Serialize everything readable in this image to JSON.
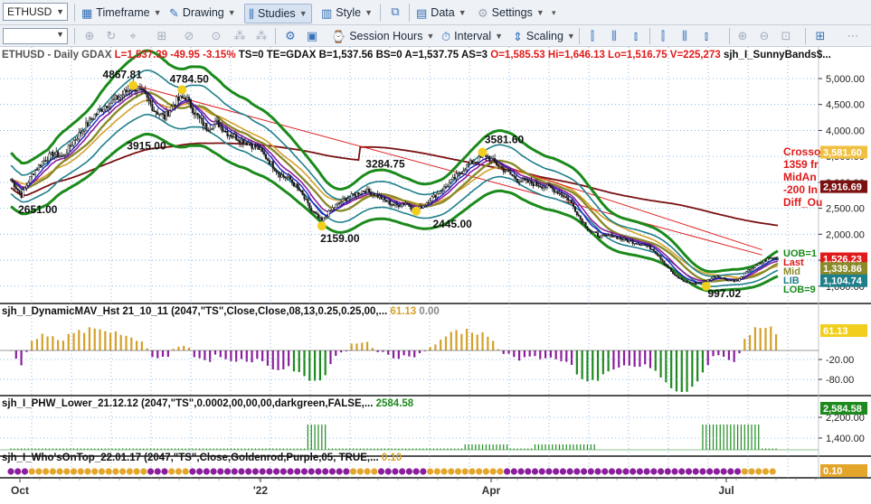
{
  "toolbar": {
    "symbol": "ETHUSD",
    "timeframe_label": "Timeframe",
    "drawing_label": "Drawing",
    "studies_label": "Studies",
    "style_label": "Style",
    "data_label": "Data",
    "settings_label": "Settings",
    "session_hours_label": "Session Hours",
    "interval_label": "Interval",
    "scaling_label": "Scaling"
  },
  "header": {
    "symbol_desc": "ETHUSD - Daily  GDAX",
    "low_change": "L=1,537.39  -49.95  -3.15%",
    "meta1": "TS=0  TE=GDAX  B=1,537.56  BS=0  A=1,537.75  AS=3",
    "ohlc": "O=1,585.53  Hi=1,646.13  Lo=1,516.75  V=225,273",
    "study": "sjh_I_SunnyBands$..."
  },
  "colors": {
    "up_candle": "#1a1a1a",
    "outer_band": "#1b8a1b",
    "inner_band": "#1f7f8a",
    "mid_blue": "#2020c8",
    "mid_purple": "#8a1e9c",
    "mid_olive": "#8a8a2a",
    "gold": "#d4a02a",
    "long_ma": "#7a1010",
    "trend": "#e02020",
    "hist_gold": "#d4a02a",
    "hist_red": "#e01a1a",
    "hist_purple": "#8a1e9c",
    "hist_green": "#1e8a1e"
  },
  "chart_data": [
    {
      "type": "candlestick",
      "title": "ETHUSD - Daily GDAX",
      "x_labels": [
        "Oct",
        "'22",
        "Apr",
        "Jul"
      ],
      "y_ticks": [
        1000,
        1500,
        2000,
        2500,
        3000,
        3500,
        4000,
        4500,
        5000
      ],
      "y_tick_labels": [
        "1,000.00",
        "1,500.00",
        "2,000.00",
        "2,500.00",
        "3,000.00",
        "3,500.00",
        "4,000.00",
        "4,500.00",
        "5,000.00"
      ],
      "ylim": [
        700,
        5400
      ],
      "close_path": [
        [
          0,
          3050
        ],
        [
          6,
          2750
        ],
        [
          12,
          3150
        ],
        [
          18,
          3400
        ],
        [
          24,
          3550
        ],
        [
          30,
          3500
        ],
        [
          36,
          3800
        ],
        [
          42,
          4050
        ],
        [
          48,
          4300
        ],
        [
          54,
          4480
        ],
        [
          60,
          4600
        ],
        [
          66,
          4750
        ],
        [
          70,
          4850
        ],
        [
          76,
          4700
        ],
        [
          82,
          4400
        ],
        [
          88,
          4250
        ],
        [
          94,
          4550
        ],
        [
          100,
          4650
        ],
        [
          106,
          4300
        ],
        [
          112,
          4050
        ],
        [
          118,
          4150
        ],
        [
          124,
          3950
        ],
        [
          130,
          3850
        ],
        [
          136,
          3750
        ],
        [
          142,
          3650
        ],
        [
          148,
          3400
        ],
        [
          154,
          3150
        ],
        [
          160,
          3050
        ],
        [
          166,
          2800
        ],
        [
          172,
          2450
        ],
        [
          178,
          2250
        ],
        [
          184,
          2500
        ],
        [
          190,
          2650
        ],
        [
          196,
          2750
        ],
        [
          202,
          2850
        ],
        [
          208,
          2780
        ],
        [
          214,
          2650
        ],
        [
          220,
          2550
        ],
        [
          226,
          2600
        ],
        [
          232,
          2450
        ],
        [
          238,
          2620
        ],
        [
          244,
          2780
        ],
        [
          250,
          2950
        ],
        [
          256,
          3150
        ],
        [
          262,
          3350
        ],
        [
          268,
          3450
        ],
        [
          272,
          3520
        ],
        [
          278,
          3350
        ],
        [
          284,
          3200
        ],
        [
          290,
          3050
        ],
        [
          296,
          3000
        ],
        [
          302,
          2950
        ],
        [
          308,
          2900
        ],
        [
          314,
          2800
        ],
        [
          320,
          2650
        ],
        [
          326,
          2300
        ],
        [
          332,
          2050
        ],
        [
          338,
          1950
        ],
        [
          344,
          1980
        ],
        [
          350,
          1900
        ],
        [
          356,
          1850
        ],
        [
          362,
          1800
        ],
        [
          368,
          1700
        ],
        [
          374,
          1450
        ],
        [
          380,
          1200
        ],
        [
          386,
          1080
        ],
        [
          392,
          1050
        ],
        [
          398,
          1100
        ],
        [
          404,
          1200
        ],
        [
          410,
          1120
        ],
        [
          416,
          1100
        ],
        [
          422,
          1300
        ],
        [
          428,
          1420
        ],
        [
          434,
          1537
        ]
      ],
      "annotations": [
        {
          "text": "4867.81",
          "value": 4867.81
        },
        {
          "text": "4784.50",
          "value": 4784.5
        },
        {
          "text": "3915.00",
          "value": 3915.0
        },
        {
          "text": "2651.00",
          "value": 2651.0
        },
        {
          "text": "2159.00",
          "value": 2159.0
        },
        {
          "text": "2445.00",
          "value": 2445.0
        },
        {
          "text": "3284.75",
          "value": 3284.75
        },
        {
          "text": "3581.60",
          "value": 3581.6
        },
        {
          "text": "997.02",
          "value": 997.02
        }
      ],
      "price_flags": [
        {
          "text": "3,581.60",
          "value": 3581.6,
          "color": "#f0c040",
          "fg": "#ffffff"
        },
        {
          "text": "2,916.69",
          "value": 2916.69,
          "color": "#7a1010",
          "fg": "#ffffff"
        },
        {
          "text": "1,526.23",
          "value": 1526.23,
          "color": "#e01a1a",
          "fg": "#ffffff"
        },
        {
          "text": "1,339.86",
          "value": 1339.86,
          "color": "#8a8a2a",
          "fg": "#ffffff"
        },
        {
          "text": "1,104.74",
          "value": 1104.74,
          "color": "#1f7f8a",
          "fg": "#ffffff"
        }
      ],
      "side_text": [
        "Crosso",
        "1359 fr",
        "MidAn",
        "-200 In",
        "Diff_Ou"
      ],
      "band_labels": [
        "UOB=1",
        "Last",
        "Mid",
        "LIB",
        "LOB=9"
      ]
    },
    {
      "type": "bar",
      "title": "sjh_I_DynamicMAV_Hst 21_10_11 (2047,\"TS\",Close,Close,08,13,0.25,0.25,00,...",
      "last_value": "61.13",
      "zero_value": "0.00",
      "y_tick_labels": [
        "-20.00",
        "-80.00"
      ],
      "flag": "61.13"
    },
    {
      "type": "bar",
      "title": "sjh_I_PHW_Lower_21.12.12 (2047,\"TS\",0.0002,00,00,00,darkgreen,FALSE,...",
      "last_value": "2584.58",
      "y_tick_labels": [
        "2,200.00",
        "1,400.00"
      ],
      "flag": "2,584.58"
    },
    {
      "type": "line",
      "title": "sjh_I_Who'sOnTop_22.01.17 (2047,\"TS\",Close,Goldenrod,Purple,05, TRUE,...",
      "last_value": "0.10",
      "flag": "0.10"
    }
  ]
}
